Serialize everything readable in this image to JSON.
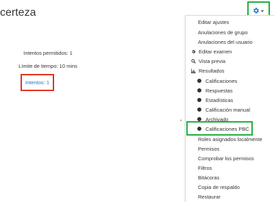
{
  "page": {
    "title": "certeza"
  },
  "quiz": {
    "attempts_allowed": "Intentos permitidos: 1",
    "time_limit": "Límite de tiempo: 10 mins",
    "attempts_link": "Intentos: 1"
  },
  "settings": {
    "gear_icon": "gear-icon",
    "caret_icon": "caret-down-icon",
    "accent": "#1e74c6"
  },
  "menu": {
    "edit_settings": "Editar ajustes",
    "group_overrides": "Anulaciones de grupo",
    "user_overrides": "Anulaciones del usuario",
    "edit_quiz": "Editar examen",
    "preview": "Vista previa",
    "results": "Resultados",
    "grades": "Calificaciones",
    "responses": "Respuestas",
    "statistics": "Estadísticas",
    "manual_grading": "Calificación manual",
    "archived": "Archivado",
    "pbc_grades": "Calificaciones PBC",
    "local_roles": "Roles asignados localmente",
    "permissions": "Permisos",
    "check_permissions": "Comprobar los permisos",
    "filters": "Filtros",
    "logs": "Bitácoras",
    "backup": "Copia de respaldo",
    "restore": "Restaurar"
  },
  "highlights": {
    "red": "#e0301e",
    "green": "#1fad3e"
  }
}
